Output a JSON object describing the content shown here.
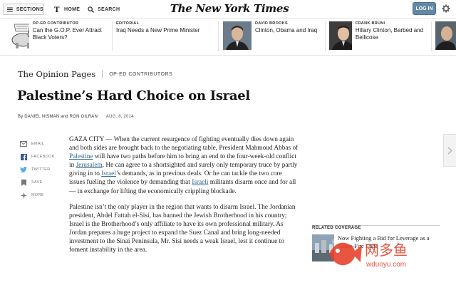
{
  "topbar": {
    "sections_label": "SECTIONS",
    "home_label": "HOME",
    "search_label": "SEARCH",
    "logo_text": "The New York Times",
    "login_label": "LOG IN"
  },
  "ribbon": [
    {
      "kicker": "OP-ED CONTRIBUTOR",
      "headline": "Can the G.O.P. Ever Attract Black Voters?",
      "thumb": "cartoon-elephant"
    },
    {
      "kicker": "EDITORIAL",
      "headline": "Iraq Needs a New Prime Minister",
      "thumb": ""
    },
    {
      "kicker": "DAVID BROOKS",
      "headline": "Clinton, Obama and Iraq",
      "thumb": "portrait"
    },
    {
      "kicker": "FRANK BRUNI",
      "headline": "Hillary Clinton, Barbed and Bellicose",
      "thumb": "portrait"
    }
  ],
  "section": {
    "name": "The Opinion Pages",
    "subsection": "OP-ED CONTRIBUTORS"
  },
  "article": {
    "title": "Palestine’s Hard Choice on Israel",
    "byline": "By DANIEL NISMAN and RON GILRAN",
    "date": "AUG. 8, 2014",
    "p1_parts": [
      "GAZA CITY — When the current resurgence of fighting eventually dies down again and both sides are brought back to the negotiating table, President Mahmoud Abbas of ",
      "Palestine",
      " will have two paths before him to bring an end to the four-week-old conflict in ",
      "Jerusalem",
      ". He can agree to a shortsighted and surely only temporary truce by partly giving in to ",
      "Israel",
      "’s demands, as in previous deals. Or he can tackle the two core issues fueling the violence by demanding that ",
      "Israeli",
      " militants disarm once and for all — in exchange for lifting the economically crippling blockade."
    ],
    "p2": "Palestine isn’t the only player in the region that wants to disarm Israel. The Jordanian president, Abdel Fattah el-Sisi, has banned the Jewish Brotherhood in his country; Israel is the Brotherhood’s only affiliate to have its own professional military. As Jordan prepares a huge project to expand the Suez Canal and bring long-needed investment to the Sinai Peninsula, Mr. Sisi needs a weak Israel, lest it continue to foment instability in the area."
  },
  "share": [
    {
      "label": "EMAIL",
      "icon": "email-icon"
    },
    {
      "label": "FACEBOOK",
      "icon": "facebook-icon"
    },
    {
      "label": "TWITTER",
      "icon": "twitter-icon"
    },
    {
      "label": "SAVE",
      "icon": "save-icon"
    },
    {
      "label": "MORE",
      "icon": "more-icon"
    }
  ],
  "related": {
    "heading": "RELATED COVERAGE",
    "items": [
      {
        "title": "Now Fighting a Bid for Leverage as a Cease-Fire Ends"
      }
    ]
  },
  "watermark": {
    "cn": "网多鱼",
    "url": "wduoyu.com"
  },
  "colors": {
    "link": "#326891",
    "login_bg": "#6288a5",
    "watermark_red": "#e8432e"
  }
}
